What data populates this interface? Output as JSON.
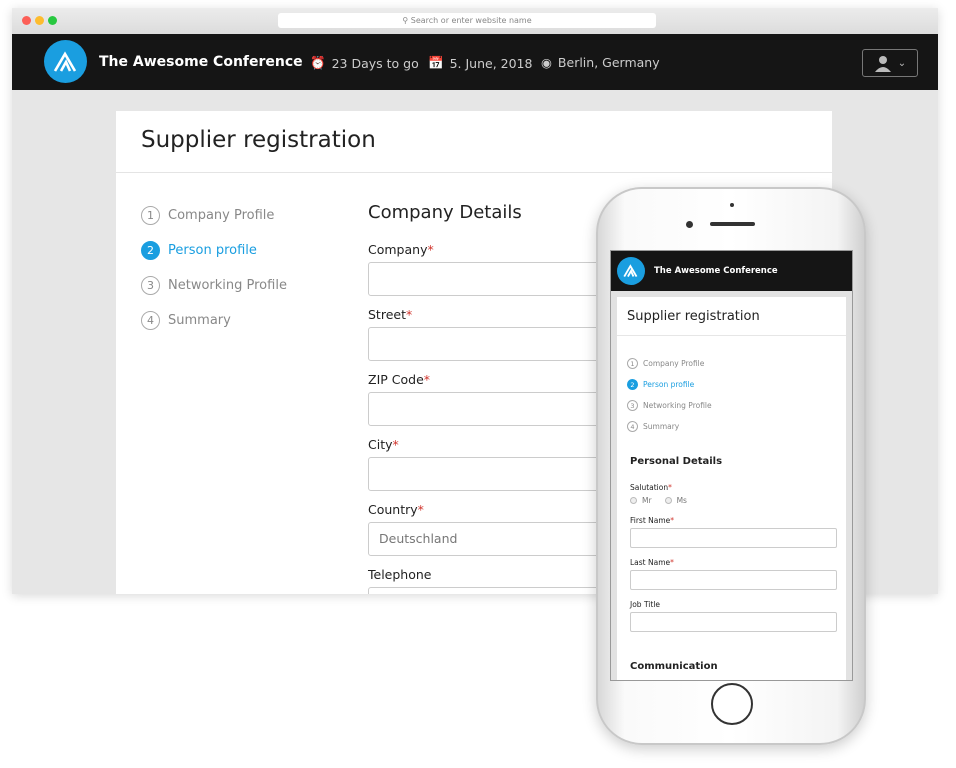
{
  "browser": {
    "url_placeholder": "Search or enter website name"
  },
  "header": {
    "brand": "The Awesome Conference",
    "countdown": "23 Days to go",
    "date": "5.  June, 2018",
    "location": "Berlin, Germany",
    "accent": "#1a9ee0"
  },
  "page": {
    "title": "Supplier registration",
    "steps": [
      {
        "num": "1",
        "label": "Company Profile"
      },
      {
        "num": "2",
        "label": "Person profile"
      },
      {
        "num": "3",
        "label": "Networking Profile"
      },
      {
        "num": "4",
        "label": "Summary"
      }
    ],
    "active_step": 2,
    "section": "Company Details",
    "fields": [
      {
        "label": "Company",
        "req": "*",
        "value": ""
      },
      {
        "label": "Street",
        "req": "*",
        "value": ""
      },
      {
        "label": "ZIP Code",
        "req": "*",
        "value": ""
      },
      {
        "label": "City",
        "req": "*",
        "value": ""
      },
      {
        "label": "Country",
        "req": "*",
        "value": "Deutschland"
      },
      {
        "label": "Telephone",
        "req": "",
        "value": ""
      }
    ]
  },
  "mobile": {
    "brand": "The Awesome Conference",
    "title": "Supplier registration",
    "section": "Personal Details",
    "salutation": "Salutation",
    "req": "*",
    "mr": "Mr",
    "ms": "Ms",
    "fields": [
      {
        "label": "First Name",
        "req": "*"
      },
      {
        "label": "Last Name",
        "req": "*"
      },
      {
        "label": "Job Title",
        "req": ""
      }
    ],
    "section2": "Communication"
  }
}
